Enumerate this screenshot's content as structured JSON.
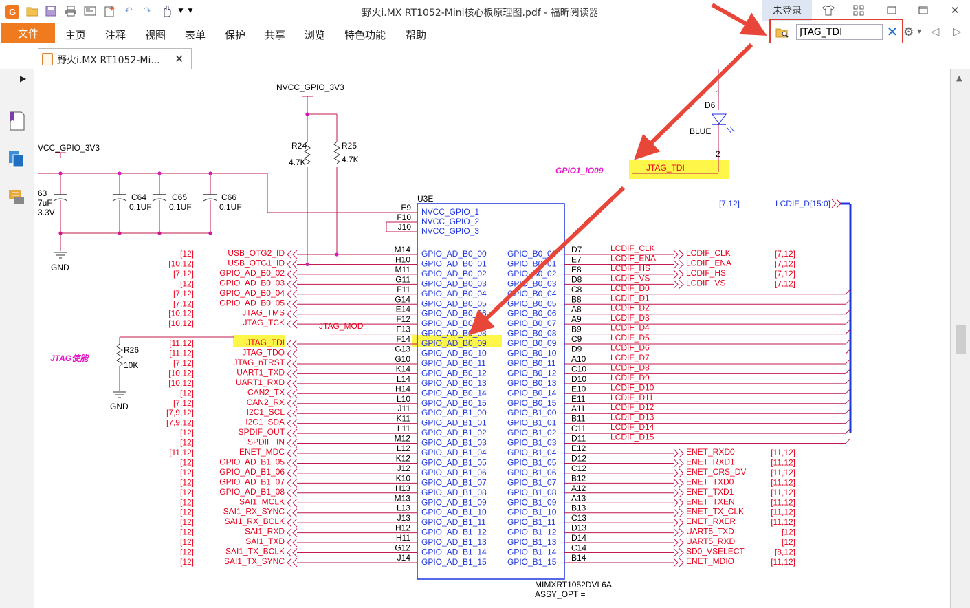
{
  "app": {
    "window_title": "野火i.MX RT1052-Mini核心板原理图.pdf - 福昕阅读器",
    "login_label": "未登录",
    "logo_letter": "G"
  },
  "menu": {
    "file": "文件",
    "items": [
      "主页",
      "注释",
      "视图",
      "表单",
      "保护",
      "共享",
      "浏览",
      "特色功能",
      "帮助"
    ]
  },
  "search": {
    "value": "JTAG_TDI"
  },
  "tab": {
    "label": "野火i.MX RT1052-Mi..."
  },
  "schematic": {
    "power_top": "NVCC_GPIO_3V3",
    "power_left": "VCC_GPIO_3V3",
    "resistors": [
      {
        "ref": "R24",
        "value": "4.7K"
      },
      {
        "ref": "R25",
        "value": "4.7K"
      },
      {
        "ref": "R26",
        "value": "10K"
      }
    ],
    "caps": [
      {
        "ref": "C64",
        "value": "0.1UF"
      },
      {
        "ref": "C65",
        "value": "0.1UF"
      },
      {
        "ref": "C66",
        "value": "0.1UF"
      }
    ],
    "cap_partial": [
      "63",
      "7uF",
      "3.3V"
    ],
    "gnd": "GND",
    "led": {
      "ref": "D6",
      "color": "BLUE",
      "pin1": "1",
      "pin2": "2"
    },
    "gpio_label": "GPIO1_IO09",
    "gpio_net": "JTAG_TDI",
    "jtag_en": "JTAG使能",
    "jtag_mod": "JTAG_MOD",
    "lcd_bus_ref": "[7,12]",
    "lcd_bus": "LCDIF_D[15:0]",
    "chip": {
      "ref": "U3E",
      "part": "MIMXRT1052DVL6A",
      "assy": "ASSY_OPT ="
    },
    "power_pins": [
      {
        "pin": "E9",
        "name": "NVCC_GPIO_1"
      },
      {
        "pin": "F10",
        "name": "NVCC_GPIO_2"
      },
      {
        "pin": "J10",
        "name": "NVCC_GPIO_3"
      }
    ],
    "left_rows": [
      {
        "ref": "[12]",
        "net": "USB_OTG2_ID",
        "pin": "M14",
        "name": "GPIO_AD_B0_00"
      },
      {
        "ref": "[10,12]",
        "net": "USB_OTG1_ID",
        "pin": "H10",
        "name": "GPIO_AD_B0_01"
      },
      {
        "ref": "[7,12]",
        "net": "GPIO_AD_B0_02",
        "pin": "M11",
        "name": "GPIO_AD_B0_02"
      },
      {
        "ref": "[12]",
        "net": "GPIO_AD_B0_03",
        "pin": "G11",
        "name": "GPIO_AD_B0_03"
      },
      {
        "ref": "[7,12]",
        "net": "GPIO_AD_B0_04",
        "pin": "F11",
        "name": "GPIO_AD_B0_04"
      },
      {
        "ref": "[7,12]",
        "net": "GPIO_AD_B0_05",
        "pin": "G14",
        "name": "GPIO_AD_B0_05"
      },
      {
        "ref": "[10,12]",
        "net": "JTAG_TMS",
        "pin": "E14",
        "name": "GPIO_AD_B0_06"
      },
      {
        "ref": "[10,12]",
        "net": "JTAG_TCK",
        "pin": "F12",
        "name": "GPIO_AD_B0_07"
      },
      {
        "ref": "",
        "net": "",
        "pin": "F13",
        "name": "GPIO_AD_B0_08"
      },
      {
        "ref": "[11,12]",
        "net": "JTAG_TDI",
        "pin": "F14",
        "name": "GPIO_AD_B0_09"
      },
      {
        "ref": "[11,12]",
        "net": "JTAG_TDO",
        "pin": "G13",
        "name": "GPIO_AD_B0_10"
      },
      {
        "ref": "[7,12]",
        "net": "JTAG_nTRST",
        "pin": "G10",
        "name": "GPIO_AD_B0_11"
      },
      {
        "ref": "[10,12]",
        "net": "UART1_TXD",
        "pin": "K14",
        "name": "GPIO_AD_B0_12"
      },
      {
        "ref": "[10,12]",
        "net": "UART1_RXD",
        "pin": "L14",
        "name": "GPIO_AD_B0_13"
      },
      {
        "ref": "[12]",
        "net": "CAN2_TX",
        "pin": "H14",
        "name": "GPIO_AD_B0_14"
      },
      {
        "ref": "[7,12]",
        "net": "CAN2_RX",
        "pin": "L10",
        "name": "GPIO_AD_B0_15"
      },
      {
        "ref": "[7,9,12]",
        "net": "I2C1_SCL",
        "pin": "J11",
        "name": "GPIO_AD_B1_00"
      },
      {
        "ref": "[7,9,12]",
        "net": "I2C1_SDA",
        "pin": "K11",
        "name": "GPIO_AD_B1_01"
      },
      {
        "ref": "[12]",
        "net": "SPDIF_OUT",
        "pin": "L11",
        "name": "GPIO_AD_B1_02"
      },
      {
        "ref": "[12]",
        "net": "SPDIF_IN",
        "pin": "M12",
        "name": "GPIO_AD_B1_03"
      },
      {
        "ref": "[11,12]",
        "net": "ENET_MDC",
        "pin": "L12",
        "name": "GPIO_AD_B1_04"
      },
      {
        "ref": "[12]",
        "net": "GPIO_AD_B1_05",
        "pin": "K12",
        "name": "GPIO_AD_B1_05"
      },
      {
        "ref": "[12]",
        "net": "GPIO_AD_B1_06",
        "pin": "J12",
        "name": "GPIO_AD_B1_06"
      },
      {
        "ref": "[12]",
        "net": "GPIO_AD_B1_07",
        "pin": "K10",
        "name": "GPIO_AD_B1_07"
      },
      {
        "ref": "[12]",
        "net": "GPIO_AD_B1_08",
        "pin": "H13",
        "name": "GPIO_AD_B1_08"
      },
      {
        "ref": "[12]",
        "net": "SAI1_MCLK",
        "pin": "M13",
        "name": "GPIO_AD_B1_09"
      },
      {
        "ref": "[12]",
        "net": "SAI1_RX_SYNC",
        "pin": "L13",
        "name": "GPIO_AD_B1_10"
      },
      {
        "ref": "[12]",
        "net": "SAI1_RX_BCLK",
        "pin": "J13",
        "name": "GPIO_AD_B1_11"
      },
      {
        "ref": "[12]",
        "net": "SAI1_RXD",
        "pin": "H12",
        "name": "GPIO_AD_B1_12"
      },
      {
        "ref": "[12]",
        "net": "SAI1_TXD",
        "pin": "H11",
        "name": "GPIO_AD_B1_13"
      },
      {
        "ref": "[12]",
        "net": "SAI1_TX_BCLK",
        "pin": "G12",
        "name": "GPIO_AD_B1_14"
      },
      {
        "ref": "[12]",
        "net": "SAI1_TX_SYNC",
        "pin": "J14",
        "name": "GPIO_AD_B1_15"
      }
    ],
    "right_rows": [
      {
        "name": "GPIO_B0_00",
        "pin": "D7",
        "wire": "LCDIF_CLK",
        "port": "LCDIF_CLK",
        "ref": "[7,12]"
      },
      {
        "name": "GPIO_B0_01",
        "pin": "E7",
        "wire": "LCDIF_ENA",
        "port": "LCDIF_ENA",
        "ref": "[7,12]"
      },
      {
        "name": "GPIO_B0_02",
        "pin": "E8",
        "wire": "LCDIF_HS",
        "port": "LCDIF_HS",
        "ref": "[7,12]"
      },
      {
        "name": "GPIO_B0_03",
        "pin": "D8",
        "wire": "LCDIF_VS",
        "port": "LCDIF_VS",
        "ref": "[7,12]"
      },
      {
        "name": "GPIO_B0_04",
        "pin": "C8",
        "wire": "LCDIF_D0",
        "port": "",
        "ref": ""
      },
      {
        "name": "GPIO_B0_05",
        "pin": "B8",
        "wire": "LCDIF_D1",
        "port": "",
        "ref": ""
      },
      {
        "name": "GPIO_B0_06",
        "pin": "A8",
        "wire": "LCDIF_D2",
        "port": "",
        "ref": ""
      },
      {
        "name": "GPIO_B0_07",
        "pin": "A9",
        "wire": "LCDIF_D3",
        "port": "",
        "ref": ""
      },
      {
        "name": "GPIO_B0_08",
        "pin": "B9",
        "wire": "LCDIF_D4",
        "port": "",
        "ref": ""
      },
      {
        "name": "GPIO_B0_09",
        "pin": "C9",
        "wire": "LCDIF_D5",
        "port": "",
        "ref": ""
      },
      {
        "name": "GPIO_B0_10",
        "pin": "D9",
        "wire": "LCDIF_D6",
        "port": "",
        "ref": ""
      },
      {
        "name": "GPIO_B0_11",
        "pin": "A10",
        "wire": "LCDIF_D7",
        "port": "",
        "ref": ""
      },
      {
        "name": "GPIO_B0_12",
        "pin": "C10",
        "wire": "LCDIF_D8",
        "port": "",
        "ref": ""
      },
      {
        "name": "GPIO_B0_13",
        "pin": "D10",
        "wire": "LCDIF_D9",
        "port": "",
        "ref": ""
      },
      {
        "name": "GPIO_B0_14",
        "pin": "E10",
        "wire": "LCDIF_D10",
        "port": "",
        "ref": ""
      },
      {
        "name": "GPIO_B0_15",
        "pin": "E11",
        "wire": "LCDIF_D11",
        "port": "",
        "ref": ""
      },
      {
        "name": "GPIO_B1_00",
        "pin": "A11",
        "wire": "LCDIF_D12",
        "port": "",
        "ref": ""
      },
      {
        "name": "GPIO_B1_01",
        "pin": "B11",
        "wire": "LCDIF_D13",
        "port": "",
        "ref": ""
      },
      {
        "name": "GPIO_B1_02",
        "pin": "C11",
        "wire": "LCDIF_D14",
        "port": "",
        "ref": ""
      },
      {
        "name": "GPIO_B1_03",
        "pin": "D11",
        "wire": "LCDIF_D15",
        "port": "",
        "ref": ""
      },
      {
        "name": "GPIO_B1_04",
        "pin": "E12",
        "wire": "",
        "port": "ENET_RXD0",
        "ref": "[11,12]"
      },
      {
        "name": "GPIO_B1_05",
        "pin": "D12",
        "wire": "",
        "port": "ENET_RXD1",
        "ref": "[11,12]"
      },
      {
        "name": "GPIO_B1_06",
        "pin": "C12",
        "wire": "",
        "port": "ENET_CRS_DV",
        "ref": "[11,12]"
      },
      {
        "name": "GPIO_B1_07",
        "pin": "B12",
        "wire": "",
        "port": "ENET_TXD0",
        "ref": "[11,12]"
      },
      {
        "name": "GPIO_B1_08",
        "pin": "A12",
        "wire": "",
        "port": "ENET_TXD1",
        "ref": "[11,12]"
      },
      {
        "name": "GPIO_B1_09",
        "pin": "A13",
        "wire": "",
        "port": "ENET_TXEN",
        "ref": "[11,12]"
      },
      {
        "name": "GPIO_B1_10",
        "pin": "B13",
        "wire": "",
        "port": "ENET_TX_CLK",
        "ref": "[11,12]"
      },
      {
        "name": "GPIO_B1_11",
        "pin": "C13",
        "wire": "",
        "port": "ENET_RXER",
        "ref": "[11,12]"
      },
      {
        "name": "GPIO_B1_12",
        "pin": "D13",
        "wire": "",
        "port": "UART5_TXD",
        "ref": "[12]"
      },
      {
        "name": "GPIO_B1_13",
        "pin": "D14",
        "wire": "",
        "port": "UART5_RXD",
        "ref": "[12]"
      },
      {
        "name": "GPIO_B1_14",
        "pin": "C14",
        "wire": "",
        "port": "SD0_VSELECT",
        "ref": "[8,12]"
      },
      {
        "name": "GPIO_B1_15",
        "pin": "B14",
        "wire": "",
        "port": "ENET_MDIO",
        "ref": "[11,12]"
      }
    ]
  },
  "colors": {
    "accent": "#f07b1f",
    "highlight": "#fff64a",
    "schematic_red": "#e8001c",
    "chip_blue": "#1f35e0",
    "label_magenta": "#e619c8",
    "annotation_arrow": "#e9463a"
  }
}
